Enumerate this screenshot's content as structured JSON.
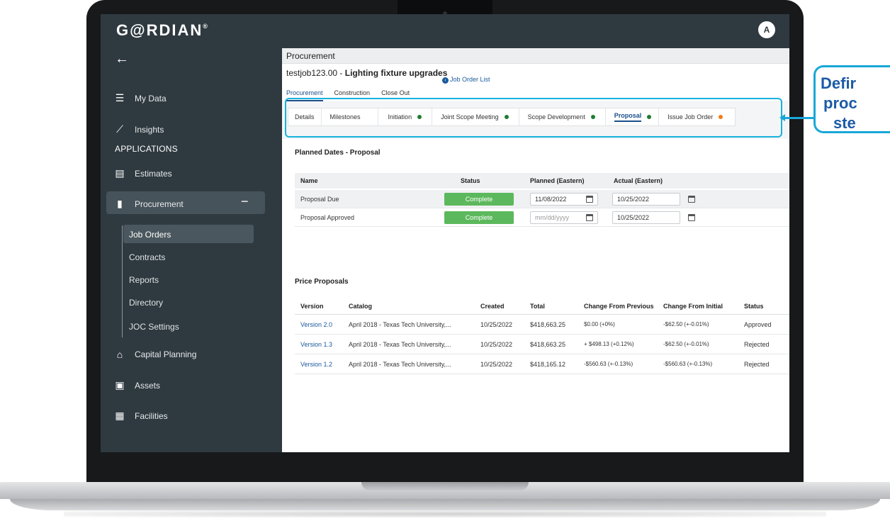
{
  "header": {
    "logo": "G@RDIAN",
    "logo_mark": "®",
    "avatar": "A"
  },
  "sidebar": {
    "back": "←",
    "my_data": "My Data",
    "insights": "Insights",
    "section": "APPLICATIONS",
    "estimates": "Estimates",
    "procurement": "Procurement",
    "collapse": "−",
    "sub_items": [
      "Job Orders",
      "Contracts",
      "Reports",
      "Directory",
      "JOC Settings"
    ],
    "capital_planning": "Capital Planning",
    "assets": "Assets",
    "facilities": "Facilities"
  },
  "main": {
    "title": "Procurement",
    "job_number": "testjob123.00 - ",
    "job_name": "Lighting fixture upgrades",
    "job_order_list": "Job Order List",
    "tabs": [
      "Procurement",
      "Construction",
      "Close Out"
    ],
    "steps": [
      {
        "label": "Details"
      },
      {
        "label": "Milestones"
      },
      {
        "label": "Initiation",
        "dot": "#1e7d32"
      },
      {
        "label": "Joint Scope Meeting",
        "dot": "#1e7d32"
      },
      {
        "label": "Scope Development",
        "dot": "#1e7d32"
      },
      {
        "label": "Proposal",
        "dot": "#1e7d32"
      },
      {
        "label": "Issue Job Order",
        "dot": "#ef7d1a"
      }
    ]
  },
  "planned": {
    "title": "Planned Dates - Proposal",
    "headers": [
      "Name",
      "Status",
      "Planned (Eastern)",
      "Actual (Eastern)"
    ],
    "rows": [
      {
        "name": "Proposal Due",
        "status": "Complete",
        "planned": "11/08/2022",
        "actual": "10/25/2022"
      },
      {
        "name": "Proposal Approved",
        "status": "Complete",
        "planned": "mm/dd/yyyy",
        "actual": "10/25/2022"
      }
    ]
  },
  "price": {
    "title": "Price Proposals",
    "headers": [
      "Version",
      "Catalog",
      "Created",
      "Total",
      "Change From Previous",
      "Change From Initial",
      "Status"
    ],
    "rows": [
      {
        "version": "Version 2.0",
        "catalog": "April 2018 - Texas Tech University,...",
        "created": "10/25/2022",
        "total": "$418,663.25",
        "prev": "$0.00 (+0%)",
        "initial": "-$62.50 (+-0.01%)",
        "status": "Approved"
      },
      {
        "version": "Version 1.3",
        "catalog": "April 2018 - Texas Tech University,...",
        "created": "10/25/2022",
        "total": "$418,663.25",
        "prev": "+ $498.13 (+0.12%)",
        "initial": "-$62.50 (+-0.01%)",
        "status": "Rejected"
      },
      {
        "version": "Version 1.2",
        "catalog": "April 2018 - Texas Tech University,...",
        "created": "10/25/2022",
        "total": "$418,165.12",
        "prev": "-$560.63 (+-0.13%)",
        "initial": "-$560.63 (+-0.13%)",
        "status": "Rejected"
      }
    ]
  },
  "callout": {
    "line1": "Defir",
    "line2": "proc",
    "line3": "ste"
  },
  "colors": {
    "accent": "#19a7d8",
    "callout_text": "#1c5aa6",
    "complete": "#5cb85c",
    "sidebar": "#2f3a40"
  }
}
